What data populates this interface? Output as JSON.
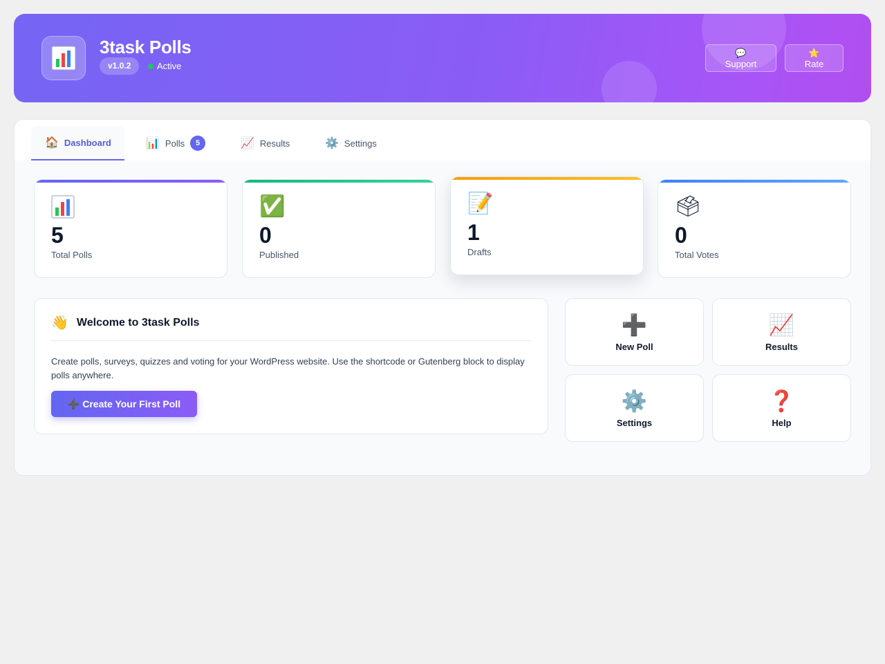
{
  "header": {
    "title": "3task Polls",
    "version": "v1.0.2",
    "status": "Active",
    "support_label": "💬 Support",
    "rate_label": "⭐ Rate"
  },
  "tabs": [
    {
      "icon": "🏠",
      "label": "Dashboard",
      "active": true
    },
    {
      "icon": "📊",
      "label": "Polls",
      "badge": "5"
    },
    {
      "icon": "📈",
      "label": "Results"
    },
    {
      "icon": "⚙️",
      "label": "Settings"
    }
  ],
  "stats": [
    {
      "icon": "📊",
      "value": "5",
      "label": "Total Polls"
    },
    {
      "icon": "✅",
      "value": "0",
      "label": "Published"
    },
    {
      "icon": "📝",
      "value": "1",
      "label": "Drafts"
    },
    {
      "icon": "🗳",
      "value": "0",
      "label": "Total Votes"
    }
  ],
  "welcome": {
    "icon": "👋",
    "title": "Welcome to 3task Polls",
    "text": "Create polls, surveys, quizzes and voting for your WordPress website. Use the shortcode or Gutenberg block to display polls anywhere.",
    "cta_label": "➕ Create Your First Poll"
  },
  "quick_actions": [
    {
      "icon": "➕",
      "label": "New Poll"
    },
    {
      "icon": "📈",
      "label": "Results"
    },
    {
      "icon": "⚙️",
      "label": "Settings"
    },
    {
      "icon": "❓",
      "label": "Help"
    }
  ],
  "colors": {
    "accent": "#6366f1",
    "header_gradient_start": "#7565f4",
    "header_gradient_end": "#b14ef0",
    "status_active": "#22c55e"
  }
}
